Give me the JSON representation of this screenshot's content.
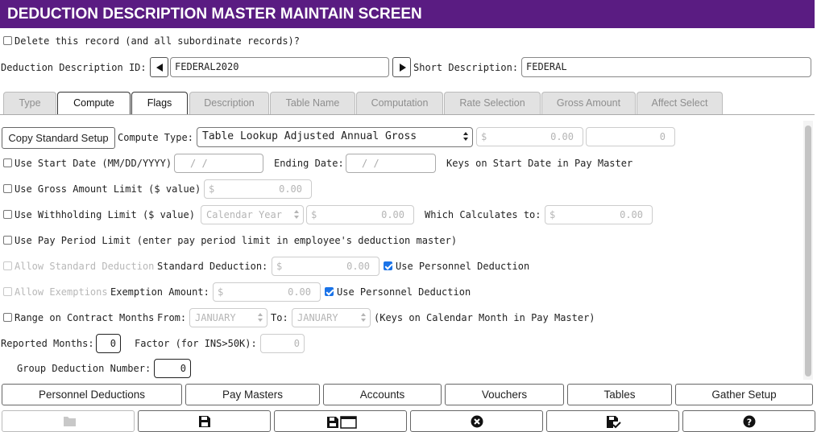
{
  "header": {
    "title": "DEDUCTION DESCRIPTION MASTER MAINTAIN SCREEN"
  },
  "delete_record": {
    "label": "Delete this record (and all subordinate records)?",
    "checked": false
  },
  "record": {
    "id_label": "Deduction Description ID:",
    "id_value": "FEDERAL2020",
    "short_label": "Short Description:",
    "short_value": "FEDERAL"
  },
  "tabs": [
    {
      "label": "Type",
      "active": false
    },
    {
      "label": "Compute",
      "active": true
    },
    {
      "label": "Flags",
      "active": true
    },
    {
      "label": "Description",
      "active": false
    },
    {
      "label": "Table Name",
      "active": false
    },
    {
      "label": "Computation",
      "active": false
    },
    {
      "label": "Rate Selection",
      "active": false
    },
    {
      "label": "Gross Amount",
      "active": false
    },
    {
      "label": "Affect Select",
      "active": false
    }
  ],
  "compute": {
    "copy_button": "Copy Standard Setup",
    "compute_type_label": "Compute Type:",
    "compute_type_value": "Table Lookup Adjusted Annual Gross",
    "amount_prefix": "$",
    "amount_value": "0.00",
    "count_value": "0",
    "use_start_date_label": "Use Start Date (MM/DD/YYYY)",
    "start_date_value": "/   /",
    "ending_date_label": "Ending Date:",
    "ending_date_value": "/   /",
    "keys_start_date": "Keys on Start Date in Pay Master",
    "gross_limit_label": "Use Gross Amount Limit ($ value)",
    "gross_limit_prefix": "$",
    "gross_limit_value": "0.00",
    "withholding_label": "Use Withholding Limit ($ value)",
    "withholding_period": "Calendar Year",
    "withholding_prefix": "$",
    "withholding_value": "0.00",
    "which_calc_label": "Which Calculates to:",
    "which_calc_prefix": "$",
    "which_calc_value": "0.00",
    "pay_period_label": "Use Pay Period Limit (enter pay period limit in employee's deduction master)",
    "allow_std_label": "Allow Standard Deduction",
    "std_ded_label": "Standard Deduction:",
    "std_ded_prefix": "$",
    "std_ded_value": "0.00",
    "use_personnel_label_1": "Use Personnel Deduction",
    "allow_exempt_label": "Allow Exemptions",
    "exempt_amount_label": "Exemption Amount:",
    "exempt_prefix": "$",
    "exempt_value": "0.00",
    "use_personnel_label_2": "Use Personnel Deduction",
    "range_label": "Range on Contract Months",
    "from_label": "From:",
    "from_value": "JANUARY",
    "to_label": "To:",
    "to_value": "JANUARY",
    "keys_calendar": "(Keys on Calendar Month in Pay Master)",
    "reported_months_label": "Reported Months:",
    "reported_months_value": "0",
    "factor_label": "Factor (for INS>50K):",
    "factor_value": "0",
    "group_ded_label": "Group Deduction Number:",
    "group_ded_value": "0"
  },
  "nav_buttons": [
    "Personnel Deductions",
    "Pay Masters",
    "Accounts",
    "Vouchers",
    "Tables",
    "Gather Setup"
  ],
  "toolbar_icons": [
    "folder-icon",
    "save-icon",
    "save-window-icon",
    "close-circle-icon",
    "save-check-icon",
    "help-icon"
  ],
  "colors": {
    "header_bg": "#5a1c82",
    "checkbox_on": "#1a73e8"
  }
}
